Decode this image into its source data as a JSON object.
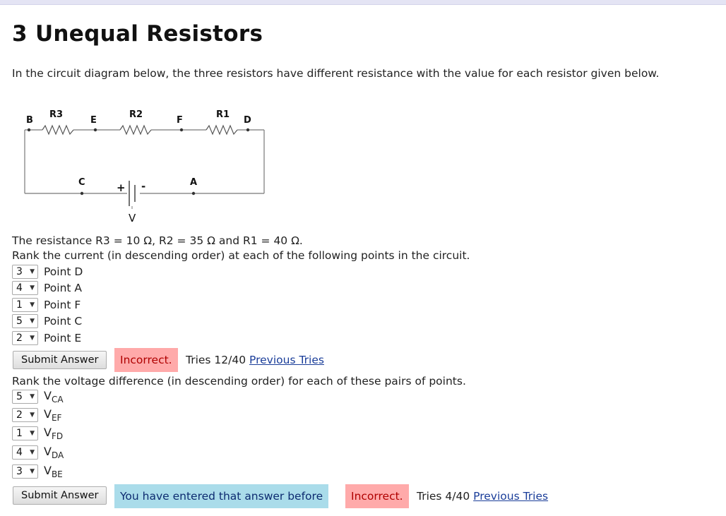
{
  "page": {
    "title": "3 Unequal Resistors",
    "intro": "In the circuit diagram below, the three resistors have different resistance with the value for each resistor given below."
  },
  "circuit": {
    "point_labels": {
      "B": "B",
      "E": "E",
      "F": "F",
      "D": "D",
      "C": "C",
      "A": "A"
    },
    "resistor_labels": {
      "r3": "R3",
      "r2": "R2",
      "r1": "R1"
    },
    "battery": {
      "plus": "+",
      "minus": "-",
      "label": "V"
    }
  },
  "given": "The resistance R3 = 10 Ω, R2 = 35 Ω and R1 = 40 Ω.",
  "q1": {
    "prompt": "Rank the current (in descending order) at each of the following points in the circuit.",
    "items": [
      {
        "rank": "3",
        "label": "Point D"
      },
      {
        "rank": "4",
        "label": "Point A"
      },
      {
        "rank": "1",
        "label": "Point F"
      },
      {
        "rank": "5",
        "label": "Point C"
      },
      {
        "rank": "2",
        "label": "Point E"
      }
    ],
    "submit_label": "Submit Answer",
    "status": "Incorrect.",
    "tries": "Tries 12/40",
    "previous_tries": "Previous Tries"
  },
  "q2": {
    "prompt": "Rank the voltage difference (in descending order) for each of these pairs of points.",
    "items": [
      {
        "rank": "5",
        "v": "V",
        "sub": "CA"
      },
      {
        "rank": "2",
        "v": "V",
        "sub": "EF"
      },
      {
        "rank": "1",
        "v": "V",
        "sub": "FD"
      },
      {
        "rank": "4",
        "v": "V",
        "sub": "DA"
      },
      {
        "rank": "3",
        "v": "V",
        "sub": "BE"
      }
    ],
    "submit_label": "Submit Answer",
    "info": "You have entered that answer before",
    "status": "Incorrect.",
    "tries": "Tries 4/40",
    "previous_tries": "Previous Tries"
  },
  "colors": {
    "incorrect_bg": "#ffaaaa",
    "info_bg": "#aadcea",
    "link": "#1a3d99"
  }
}
